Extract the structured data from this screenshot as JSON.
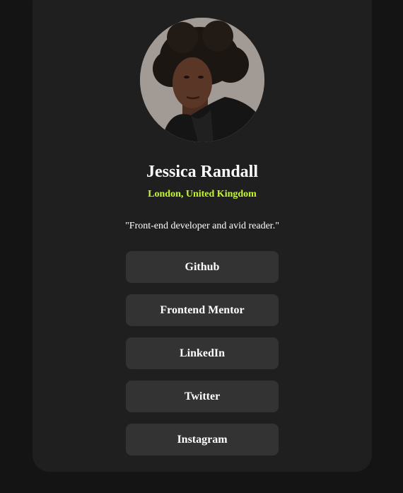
{
  "profile": {
    "name": "Jessica Randall",
    "location": "London, United Kingdom",
    "bio": "\"Front-end developer and avid reader.\""
  },
  "links": [
    {
      "label": "Github"
    },
    {
      "label": "Frontend Mentor"
    },
    {
      "label": "LinkedIn"
    },
    {
      "label": "Twitter"
    },
    {
      "label": "Instagram"
    }
  ],
  "colors": {
    "page_background": "#141414",
    "card_background": "#1f1f1f",
    "button_background": "#333333",
    "accent": "#c4f82a",
    "text": "#ffffff"
  }
}
